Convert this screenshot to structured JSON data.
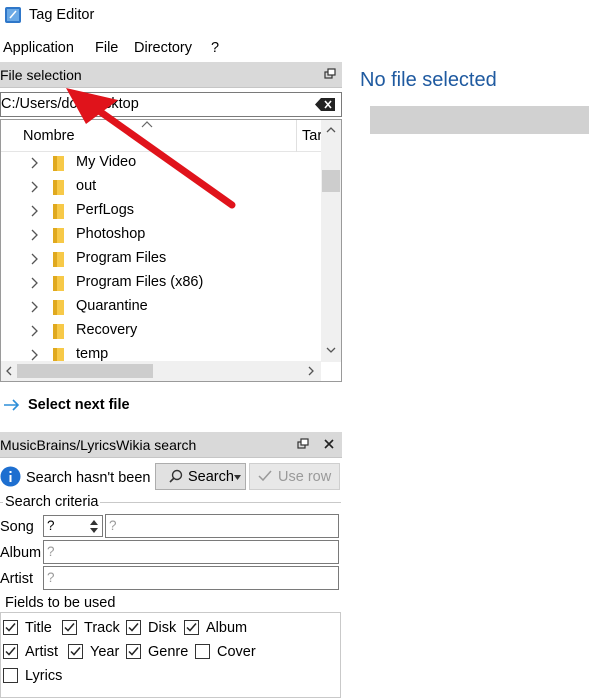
{
  "window": {
    "title": "Tag Editor"
  },
  "menu": [
    {
      "label": "Application"
    },
    {
      "label": "File"
    },
    {
      "label": "Directory"
    },
    {
      "label": "?"
    }
  ],
  "file_selection": {
    "title": "File selection",
    "path": "C:/Users/do   /Desktop",
    "columns": {
      "name": "Nombre",
      "size": "Tar"
    },
    "folders": [
      "My Video",
      "out",
      "PerfLogs",
      "Photoshop",
      "Program Files",
      "Program Files (x86)",
      "Quarantine",
      "Recovery",
      "temp"
    ],
    "select_next_label": "Select next file"
  },
  "musicbrainz": {
    "title": "MusicBrains/LyricsWikia search",
    "status": "Search hasn't been",
    "search_label": "Search",
    "use_row_label": "Use row",
    "criteria_title": "Search criteria",
    "song_label": "Song",
    "song_value": "?",
    "song_placeholder": "?",
    "album_label": "Album",
    "album_placeholder": "?",
    "artist_label": "Artist",
    "artist_placeholder": "?",
    "fields_title": "Fields to be used",
    "fields": [
      {
        "label": "Title",
        "checked": true
      },
      {
        "label": "Track",
        "checked": true
      },
      {
        "label": "Disk",
        "checked": true
      },
      {
        "label": "Album",
        "checked": true
      },
      {
        "label": "Artist",
        "checked": true
      },
      {
        "label": "Year",
        "checked": true
      },
      {
        "label": "Genre",
        "checked": true
      },
      {
        "label": "Cover",
        "checked": false
      },
      {
        "label": "Lyrics",
        "checked": false
      }
    ]
  },
  "editor": {
    "title": "No file selected"
  },
  "colors": {
    "accent": "#1f5aa0",
    "annotation_arrow": "#e0131b",
    "header_bg": "#d9d9d9"
  }
}
